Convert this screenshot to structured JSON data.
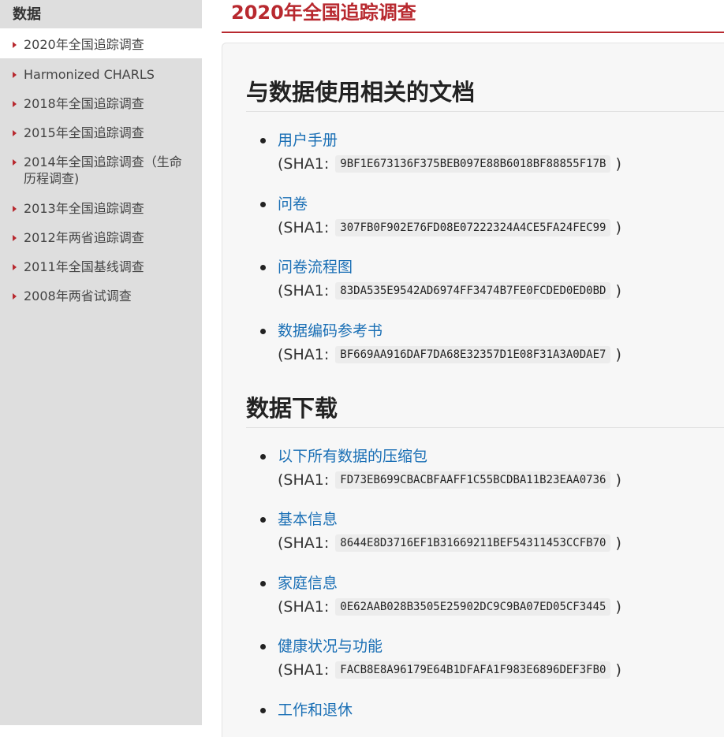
{
  "sidebar": {
    "heading": "数据",
    "items": [
      {
        "label": "2020年全国追踪调查"
      },
      {
        "label": "Harmonized CHARLS"
      },
      {
        "label": "2018年全国追踪调查"
      },
      {
        "label": "2015年全国追踪调查"
      },
      {
        "label": "2014年全国追踪调查（生命历程调查)"
      },
      {
        "label": "2013年全国追踪调查"
      },
      {
        "label": "2012年两省追踪调查"
      },
      {
        "label": "2011年全国基线调查"
      },
      {
        "label": "2008年两省试调查"
      }
    ]
  },
  "page": {
    "title": "2020年全国追踪调查"
  },
  "sections": [
    {
      "heading": "与数据使用相关的文档",
      "entries": [
        {
          "label": "用户手册",
          "sha_prefix": "(SHA1:",
          "sha": "9BF1E673136F375BEB097E88B6018BF88855F17B",
          "sha_suffix": ")"
        },
        {
          "label": "问卷",
          "sha_prefix": "(SHA1:",
          "sha": "307FB0F902E76FD08E07222324A4CE5FA24FEC99",
          "sha_suffix": ")"
        },
        {
          "label": "问卷流程图",
          "sha_prefix": "(SHA1:",
          "sha": "83DA535E9542AD6974FF3474B7FE0FCDED0ED0BD",
          "sha_suffix": ")"
        },
        {
          "label": "数据编码参考书",
          "sha_prefix": "(SHA1:",
          "sha": "BF669AA916DAF7DA68E32357D1E08F31A3A0DAE7",
          "sha_suffix": ")"
        }
      ]
    },
    {
      "heading": "数据下载",
      "entries": [
        {
          "label": "以下所有数据的压缩包",
          "sha_prefix": "(SHA1:",
          "sha": "FD73EB699CBACBFAAFF1C55BCDBA11B23EAA0736",
          "sha_suffix": ")"
        },
        {
          "label": "基本信息",
          "sha_prefix": "(SHA1:",
          "sha": "8644E8D3716EF1B31669211BEF54311453CCFB70",
          "sha_suffix": ")"
        },
        {
          "label": "家庭信息",
          "sha_prefix": "(SHA1:",
          "sha": "0E62AAB028B3505E25902DC9C9BA07ED05CF3445",
          "sha_suffix": ")"
        },
        {
          "label": "健康状况与功能",
          "sha_prefix": "(SHA1:",
          "sha": "FACB8E8A96179E64B1DFAFA1F983E6896DEF3FB0",
          "sha_suffix": ")"
        },
        {
          "label": "工作和退休"
        }
      ]
    }
  ]
}
